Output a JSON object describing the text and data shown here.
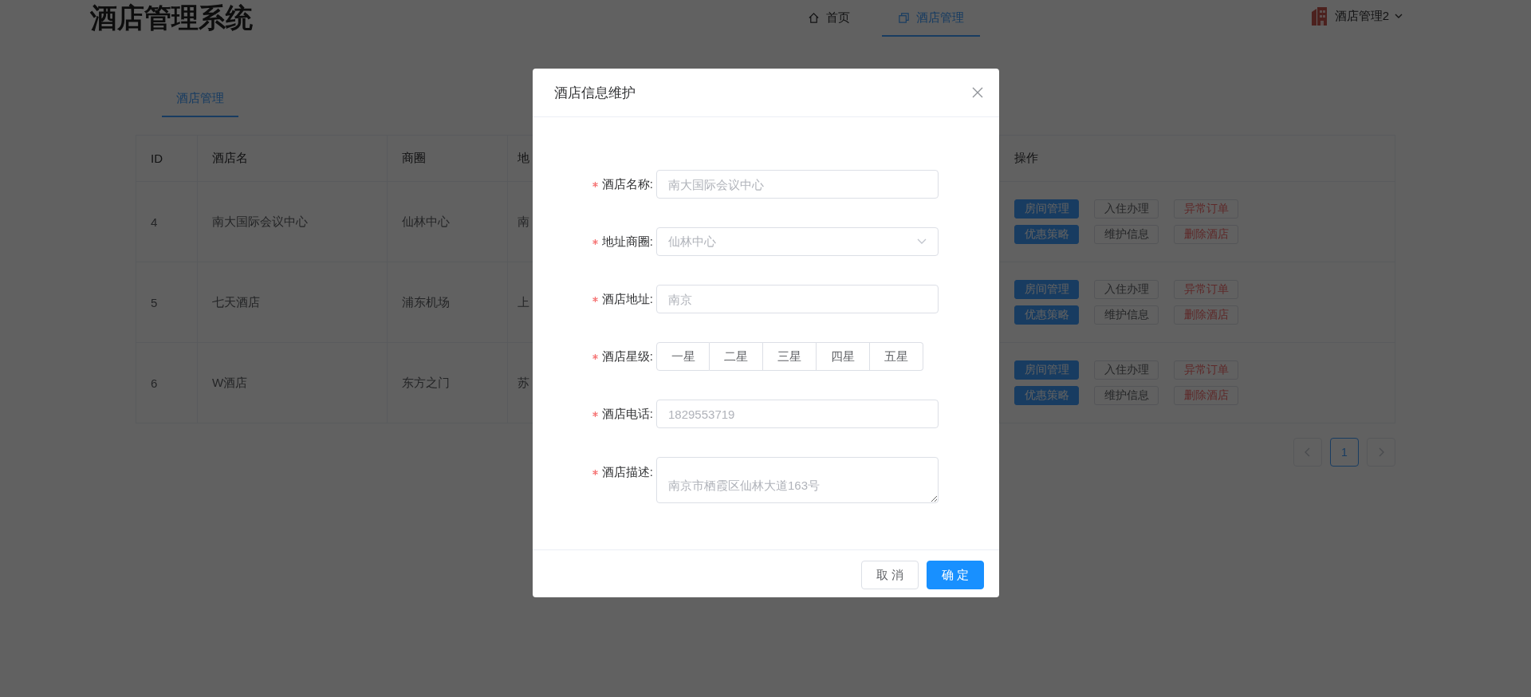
{
  "header": {
    "title": "酒店管理系统",
    "nav": [
      {
        "label": "首页",
        "selected": false
      },
      {
        "label": "酒店管理",
        "selected": true
      }
    ],
    "user": {
      "name": "酒店管理2"
    }
  },
  "tabs": [
    {
      "label": "酒店管理",
      "selected": true
    }
  ],
  "table": {
    "columns": [
      "ID",
      "酒店名",
      "商圈",
      "地",
      "操作"
    ],
    "rows": [
      {
        "cells": [
          "4",
          "南大国际会议中心",
          "仙林中心",
          "南"
        ],
        "actions": [
          {
            "label": "房间管理",
            "kind": "primary"
          },
          {
            "label": "入住办理",
            "kind": "default"
          },
          {
            "label": "异常订单",
            "kind": "danger"
          },
          {
            "label": "优惠策略",
            "kind": "primary"
          },
          {
            "label": "维护信息",
            "kind": "default"
          },
          {
            "label": "删除酒店",
            "kind": "danger"
          }
        ]
      },
      {
        "cells": [
          "5",
          "七天酒店",
          "浦东机场",
          "上"
        ],
        "actions": [
          {
            "label": "房间管理",
            "kind": "primary"
          },
          {
            "label": "入住办理",
            "kind": "default"
          },
          {
            "label": "异常订单",
            "kind": "danger"
          },
          {
            "label": "优惠策略",
            "kind": "primary"
          },
          {
            "label": "维护信息",
            "kind": "default"
          },
          {
            "label": "删除酒店",
            "kind": "danger"
          }
        ]
      },
      {
        "cells": [
          "6",
          "W酒店",
          "东方之门",
          "苏"
        ],
        "actions": [
          {
            "label": "房间管理",
            "kind": "primary"
          },
          {
            "label": "入住办理",
            "kind": "default"
          },
          {
            "label": "异常订单",
            "kind": "danger"
          },
          {
            "label": "优惠策略",
            "kind": "primary"
          },
          {
            "label": "维护信息",
            "kind": "default"
          },
          {
            "label": "删除酒店",
            "kind": "danger"
          }
        ]
      }
    ]
  },
  "pagination": {
    "pages": [
      {
        "label": "1",
        "selected": true
      }
    ]
  },
  "dialog": {
    "title": "酒店信息维护",
    "fields": [
      {
        "kind": "input",
        "label": "酒店名称:",
        "required": true,
        "placeholder": "南大国际会议中心"
      },
      {
        "kind": "select",
        "label": "地址商圈:",
        "required": true,
        "placeholder": "仙林中心"
      },
      {
        "kind": "input",
        "label": "酒店地址:",
        "required": true,
        "placeholder": "南京"
      },
      {
        "kind": "radio",
        "label": "酒店星级:",
        "required": true,
        "options": [
          {
            "label": "一星",
            "selected": false
          },
          {
            "label": "二星",
            "selected": false
          },
          {
            "label": "三星",
            "selected": false
          },
          {
            "label": "四星",
            "selected": false
          },
          {
            "label": "五星",
            "selected": false
          }
        ]
      },
      {
        "kind": "input",
        "label": "酒店电话:",
        "required": true,
        "placeholder": "1829553719"
      },
      {
        "kind": "textarea",
        "label": "酒店描述:",
        "required": true,
        "placeholder": "南京市栖霞区仙林大道163号"
      }
    ],
    "buttons": [
      {
        "label": "取 消",
        "kind": "default"
      },
      {
        "label": "确 定",
        "kind": "primary"
      }
    ]
  }
}
